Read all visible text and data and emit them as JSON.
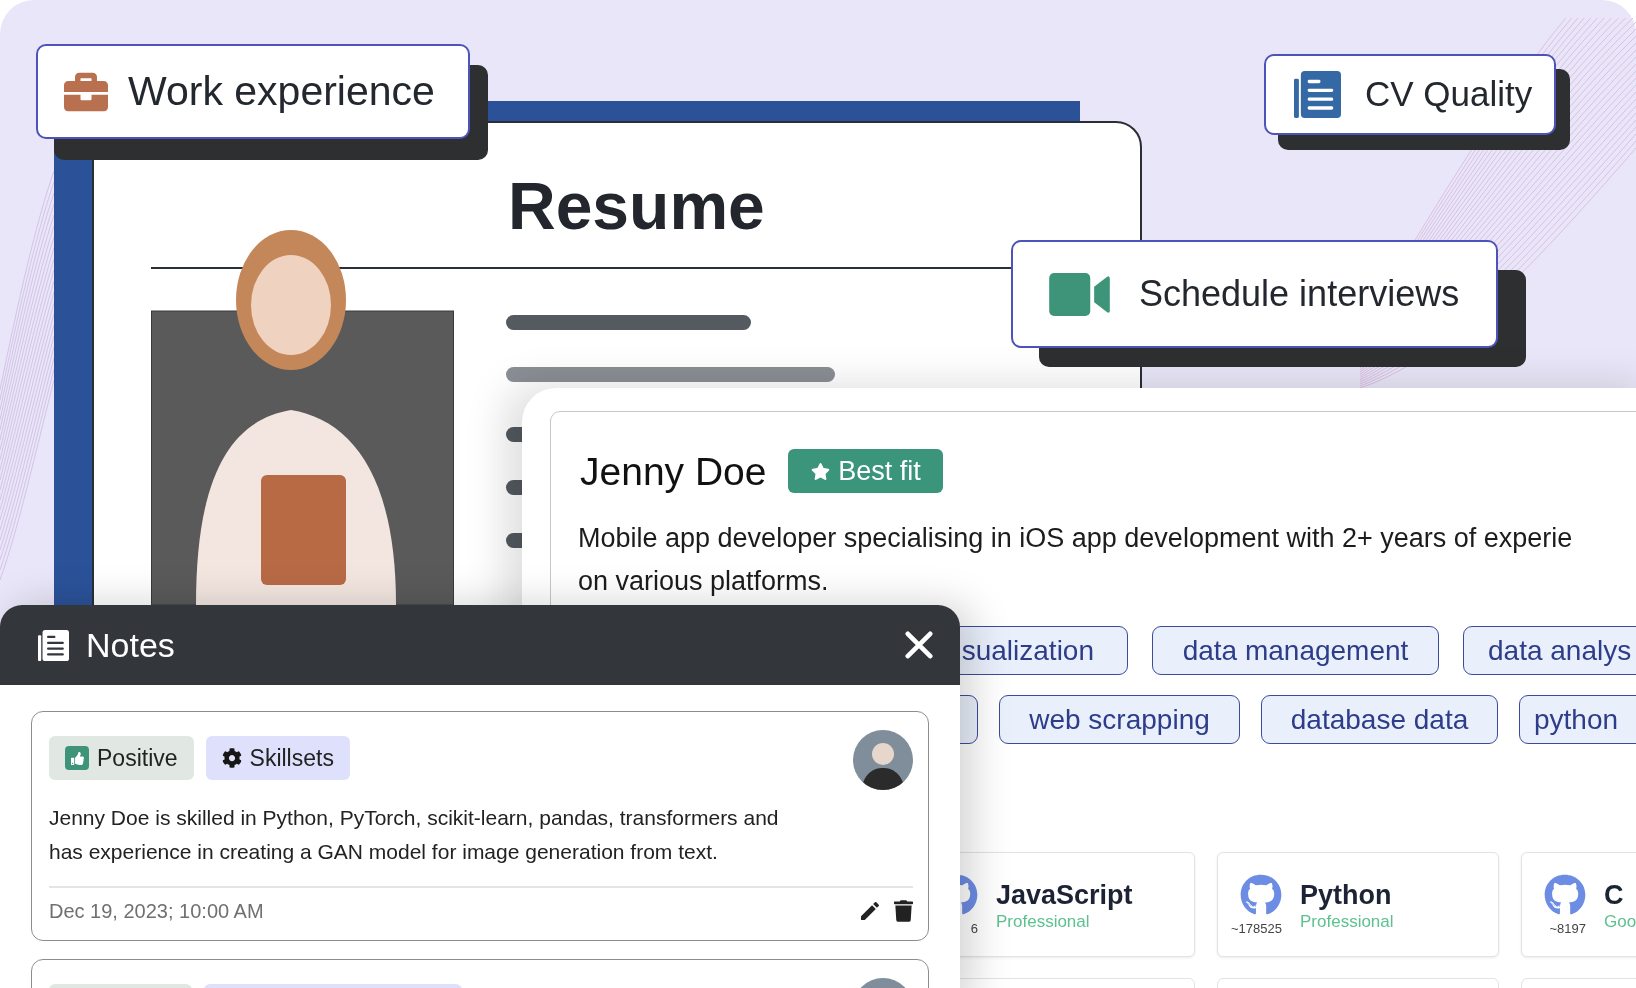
{
  "badges": [
    {
      "kind": "briefcase",
      "label": "Work experience"
    },
    {
      "kind": "document",
      "label": "CV Quality"
    },
    {
      "kind": "video",
      "label": "Schedule interviews"
    }
  ],
  "resume": {
    "title": "Resume"
  },
  "profile": {
    "name": "Jenny Doe",
    "badge": "Best fit",
    "description_lines": [
      "Mobile app developer specialising in iOS app development with 2+ years of experie",
      "on various platforms."
    ],
    "tag_rows": [
      [
        "sualization",
        "data management",
        "data analys"
      ],
      [
        "web scrapping",
        "database data",
        "python"
      ]
    ],
    "skills": [
      {
        "count": "6",
        "name": "JavaScript",
        "proficiency": "Professional"
      },
      {
        "count": "~178525",
        "name": "Python",
        "proficiency": "Professional"
      },
      {
        "count": "~8197",
        "name": "C",
        "proficiency": "Goo"
      }
    ]
  },
  "notes": {
    "title": "Notes",
    "items": [
      {
        "tags": [
          {
            "kind": "positive",
            "label": "Positive"
          },
          {
            "kind": "skillsets",
            "label": "Skillsets"
          }
        ],
        "text": "Jenny Doe is skilled in Python, PyTorch, scikit-learn, pandas, transformers and has experience in creating a GAN model for image generation from text.",
        "date": "Dec 19, 2023; 10:00 AM"
      },
      {
        "tags": [
          {
            "kind": "positive"
          },
          {
            "kind": "skillsets"
          }
        ]
      }
    ]
  }
}
